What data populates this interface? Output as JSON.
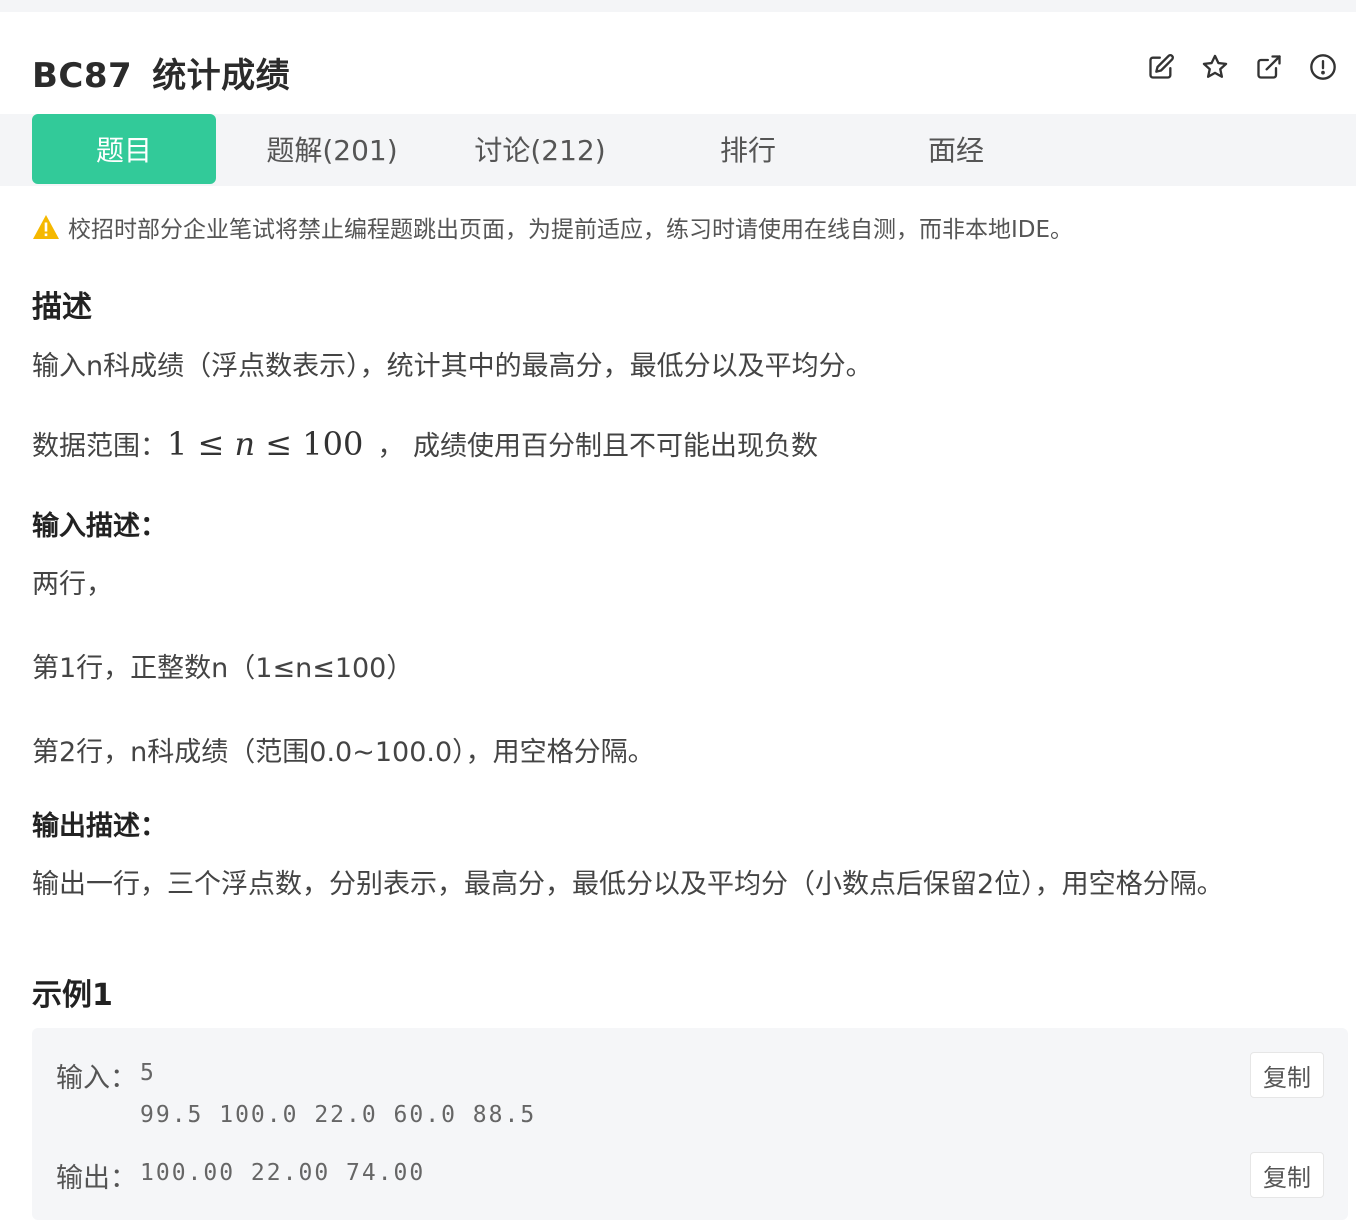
{
  "problem": {
    "id": "BC87",
    "title": "统计成绩"
  },
  "header_icons": [
    "edit-icon",
    "star-icon",
    "external-link-icon",
    "report-icon"
  ],
  "tabs": [
    {
      "label": "题目",
      "active": true
    },
    {
      "label": "题解(201)",
      "active": false
    },
    {
      "label": "讨论(212)",
      "active": false
    },
    {
      "label": "排行",
      "active": false
    },
    {
      "label": "面经",
      "active": false
    }
  ],
  "colors": {
    "accent": "#32ca99",
    "warning": "#f5b800",
    "tab_bg": "#f4f5f7"
  },
  "notice": "校招时部分企业笔试将禁止编程题跳出页面，为提前适应，练习时请使用在线自测，而非本地IDE。",
  "description": {
    "heading": "描述",
    "text": "输入n科成绩（浮点数表示），统计其中的最高分，最低分以及平均分。",
    "range_prefix": "数据范围：",
    "range_math": {
      "low": "1",
      "op": "≤",
      "var": "n",
      "high": "100"
    },
    "range_suffix": "，  成绩使用百分制且不可能出现负数"
  },
  "input_desc": {
    "heading": "输入描述：",
    "lines": [
      "两行，",
      "第1行，正整数n（1≤n≤100）",
      "第2行，n科成绩（范围0.0~100.0），用空格分隔。"
    ]
  },
  "output_desc": {
    "heading": "输出描述：",
    "text": "输出一行，三个浮点数，分别表示，最高分，最低分以及平均分（小数点后保留2位），用空格分隔。"
  },
  "example": {
    "heading": "示例1",
    "input_label": "输入：",
    "input_lines": [
      "5",
      "99.5 100.0 22.0 60.0 88.5"
    ],
    "output_label": "输出：",
    "output_line": "100.00 22.00 74.00",
    "copy_label": "复制"
  }
}
